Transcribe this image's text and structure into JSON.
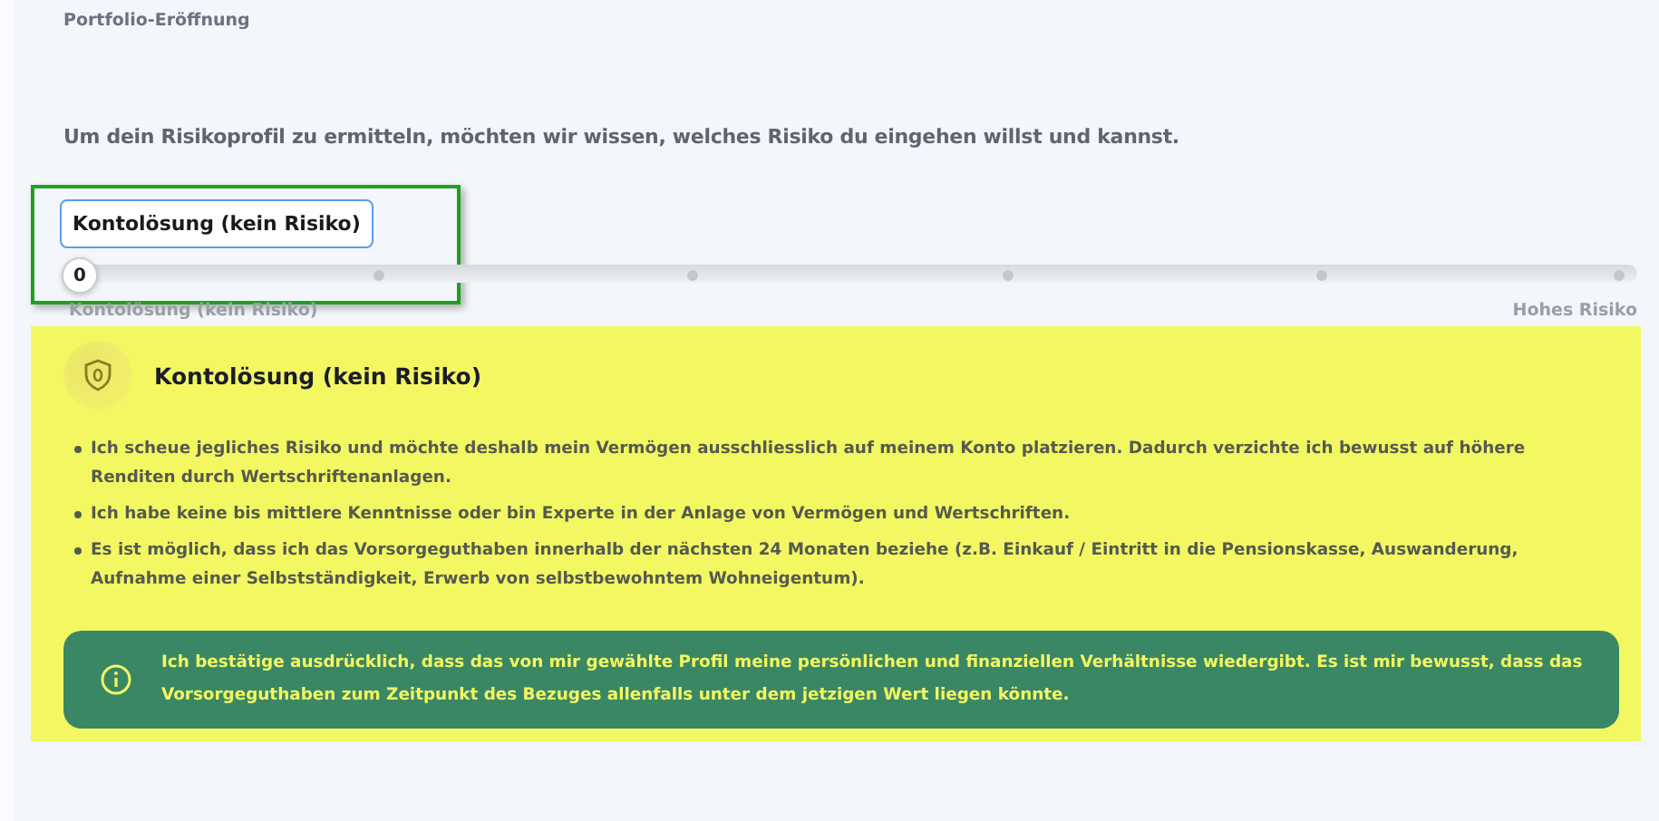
{
  "breadcrumb": "Portfolio-Eröffnung",
  "intro": "Um dein Risikoprofil zu ermitteln, möchten wir wissen, welches Risiko du eingehen willst und kannst.",
  "slider": {
    "level": 0,
    "tooltip": "Kontolösung (kein Risiko)",
    "thumb_label": "0",
    "min_label": "Kontolösung (kein Risiko)",
    "max_label": "Hohes Risiko",
    "highlighted": true
  },
  "profile": {
    "title": "Kontolösung (kein Risiko)",
    "points": [
      "Ich scheue jegliches Risiko und möchte deshalb mein Vermögen ausschliesslich auf meinem Konto platzieren. Dadurch verzichte ich bewusst auf höhere Renditen durch Wertschriftenanlagen.",
      "Ich habe keine bis mittlere Kenntnisse oder bin Experte in der Anlage von Vermögen und Wertschriften.",
      "Es ist möglich, dass ich das Vorsorgeguthaben innerhalb der nächsten 24 Monaten beziehe (z.B. Einkauf / Eintritt in die Pensionskasse, Auswanderung, Aufnahme einer Selbstständigkeit, Erwerb von selbstbewohntem Wohneigentum)."
    ],
    "confirmation": "Ich bestätige ausdrücklich, dass das von mir gewählte Profil meine persönlichen und finanziellen Verhältnisse wiedergibt. Es ist mir bewusst, dass das Vorsorgeguthaben zum Zeitpunkt des Bezuges allenfalls unter dem jetzigen Wert liegen könnte."
  }
}
